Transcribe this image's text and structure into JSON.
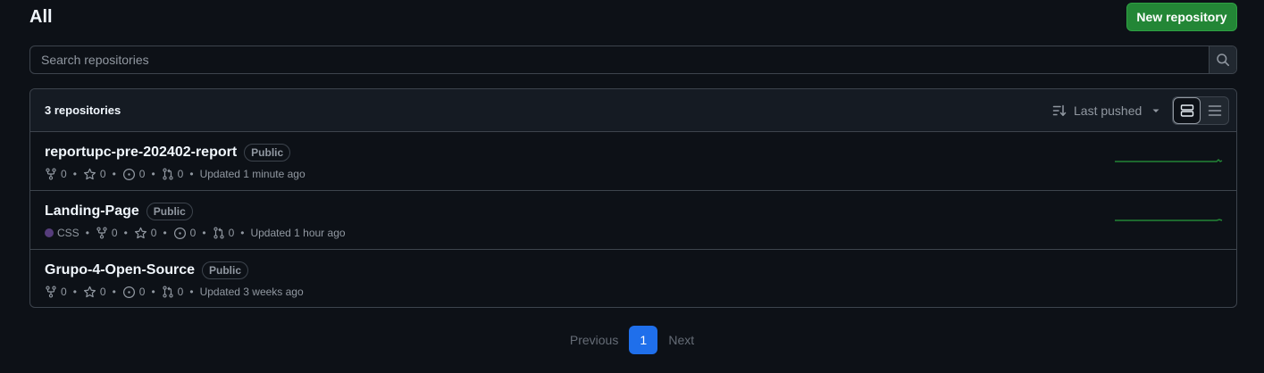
{
  "header": {
    "title": "All",
    "new_repo_label": "New repository"
  },
  "search": {
    "placeholder": "Search repositories"
  },
  "list": {
    "count_label": "3 repositories",
    "sort_label": "Last pushed",
    "repos": [
      {
        "name": "reportupc-pre-202402-report",
        "visibility": "Public",
        "language": null,
        "forks": "0",
        "stars": "0",
        "issues": "0",
        "pulls": "0",
        "updated": "Updated 1 minute ago",
        "has_activity": true
      },
      {
        "name": "Landing-Page",
        "visibility": "Public",
        "language": "CSS",
        "language_color": "#563d7c",
        "forks": "0",
        "stars": "0",
        "issues": "0",
        "pulls": "0",
        "updated": "Updated 1 hour ago",
        "has_activity": true
      },
      {
        "name": "Grupo-4-Open-Source",
        "visibility": "Public",
        "language": null,
        "forks": "0",
        "stars": "0",
        "issues": "0",
        "pulls": "0",
        "updated": "Updated 3 weeks ago",
        "has_activity": false
      }
    ]
  },
  "pagination": {
    "previous": "Previous",
    "current": "1",
    "next": "Next"
  },
  "colors": {
    "background": "#0d1117",
    "primary_button": "#238636",
    "page_active": "#1f6feb",
    "sparkline": "#238636"
  }
}
